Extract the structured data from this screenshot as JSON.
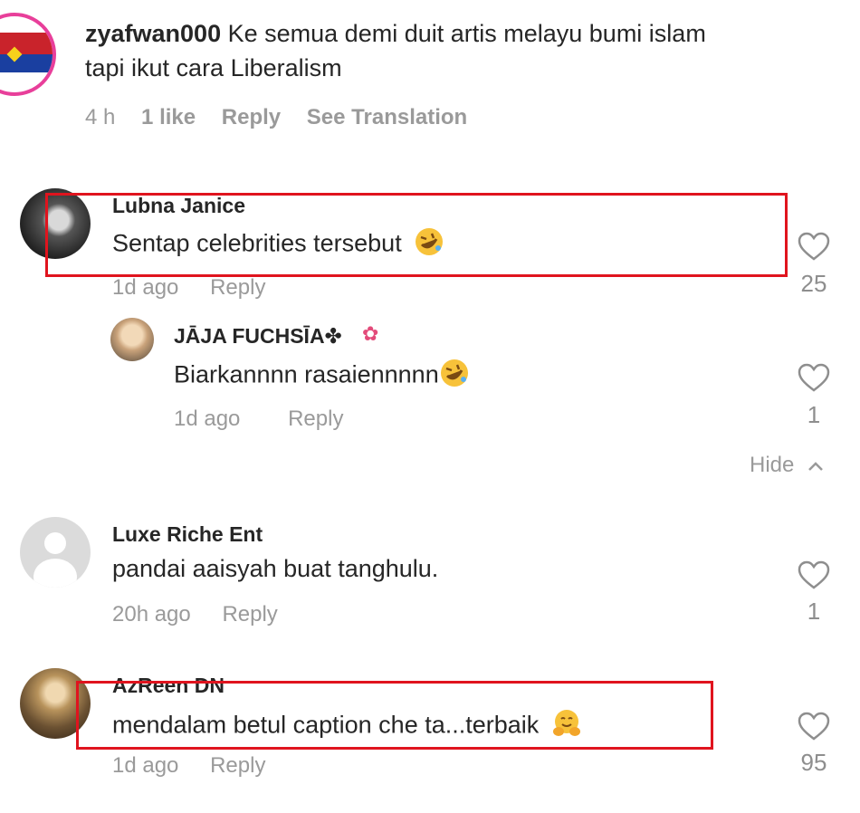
{
  "comments": {
    "top": {
      "username": "zyafwan000",
      "text_line1": "Ke semua demi duit artis melayu bumi islam",
      "text_line2": "tapi ikut cara Liberalism",
      "time": "4 h",
      "likes": "1 like",
      "reply": "Reply",
      "translation": "See Translation"
    },
    "lubna": {
      "username": "Lubna Janice",
      "text": "Sentap celebrities tersebut",
      "emoji": "rolling-on-floor-laughing-emoji",
      "time": "1d ago",
      "reply": "Reply",
      "like_count": "25"
    },
    "jaja": {
      "username": "JĀJA FUCHSĪA✤",
      "text": "Biarkannnn rasaiennnnn",
      "emoji": "rolling-on-floor-laughing-emoji",
      "time": "1d ago",
      "reply": "Reply",
      "like_count": "1"
    },
    "hide_label": "Hide",
    "luxe": {
      "username": "Luxe Riche Ent",
      "text": "pandai aaisyah buat tanghulu.",
      "time": "20h ago",
      "reply": "Reply",
      "like_count": "1"
    },
    "azreen": {
      "username": "AzReen DN",
      "text": "mendalam betul caption che ta...terbaik",
      "emoji": "hugging-face-emoji",
      "time": "1d ago",
      "reply": "Reply",
      "like_count": "95"
    }
  },
  "colors": {
    "highlight": "#e0141e",
    "meta_text": "#9a9a9a",
    "primary_text": "#262626"
  }
}
